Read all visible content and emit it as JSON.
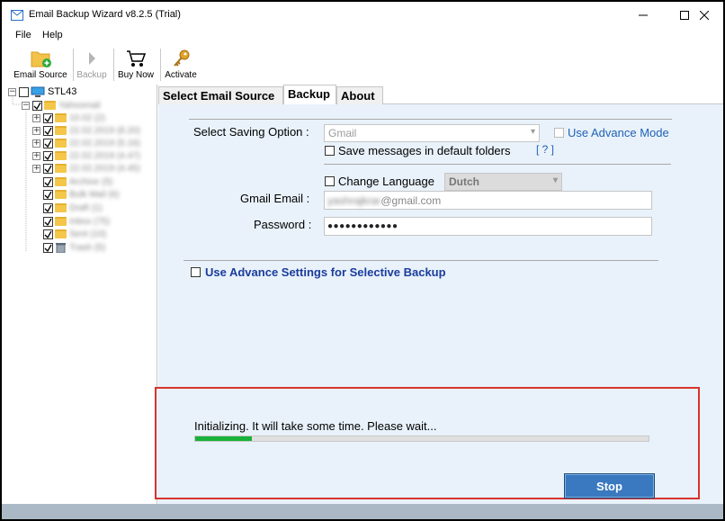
{
  "window": {
    "title": "Email Backup Wizard v8.2.5 (Trial)"
  },
  "menu": {
    "items": [
      "File",
      "Help"
    ]
  },
  "toolbar": {
    "email_source": "Email Source",
    "backup": "Backup",
    "buy_now": "Buy Now",
    "activate": "Activate"
  },
  "tree": {
    "root": "STL43",
    "account": "Yahoomail",
    "folders": [
      "10.02 (2)",
      "22.02.2019 (8.20)",
      "22.02.2019 (5.16)",
      "22.02.2019 (4.47)",
      "22.02.2019 (4.45)",
      "Archive (5)",
      "Bulk Mail (6)",
      "Draft (1)",
      "Inbox (75)",
      "Sent (10)",
      "Trash (5)"
    ]
  },
  "tabs": [
    "Select Email Source",
    "Backup",
    "About"
  ],
  "active_tab": "Backup",
  "backup": {
    "saving_option_label": "Select Saving Option :",
    "saving_option_value": "Gmail",
    "use_advance_mode": "Use Advance Mode",
    "save_default_folders": "Save messages in default folders",
    "help_link": "[ ? ]",
    "change_language": "Change Language",
    "language_value": "Dutch",
    "gmail_email_label": "Gmail Email :",
    "gmail_email_user": "yashrajkrar",
    "gmail_email_domain": "@gmail.com",
    "password_label": "Password :",
    "password_value": "●●●●●●●●●●●●",
    "advance_settings": "Use Advance Settings for Selective Backup"
  },
  "progress": {
    "message": "Initializing. It will take some time. Please wait...",
    "fraction": 0.125,
    "stop_label": "Stop"
  },
  "colors": {
    "pane_bg": "#e9f2fa",
    "progress_fill": "#17b23a",
    "highlight_border": "#d9322e",
    "stop_button": "#3a79bf",
    "link": "#1f62b6"
  }
}
